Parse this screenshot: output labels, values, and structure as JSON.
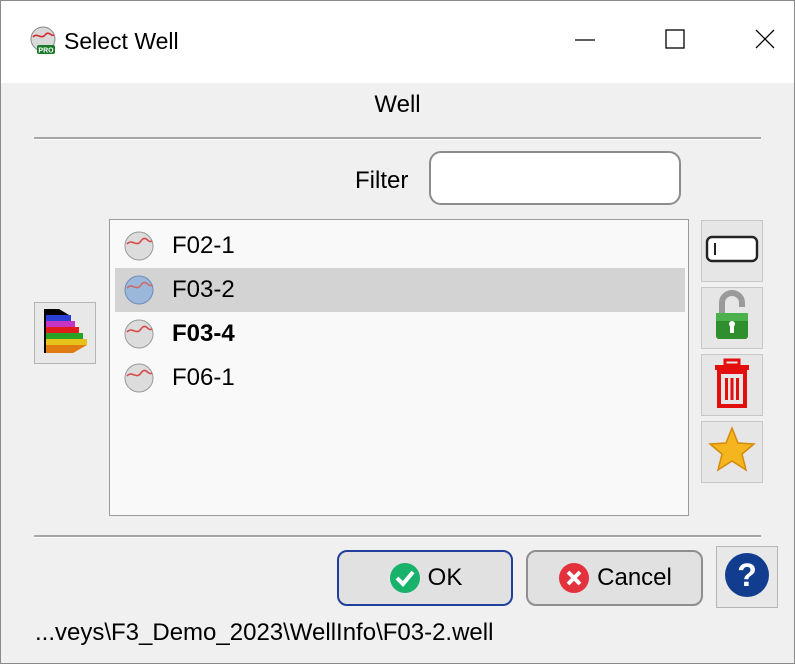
{
  "window": {
    "title": "Select Well",
    "minimize_icon": "minimize-icon",
    "maximize_icon": "maximize-icon",
    "close_icon": "close-icon"
  },
  "header": {
    "title": "Well"
  },
  "filter": {
    "label": "Filter",
    "value": "",
    "placeholder": ""
  },
  "list": {
    "items": [
      {
        "label": "F02-1",
        "icon": "well-icon",
        "selected": false,
        "bold": false
      },
      {
        "label": "F03-2",
        "icon": "well-icon-selected",
        "selected": true,
        "bold": false
      },
      {
        "label": "F03-4",
        "icon": "well-icon",
        "selected": false,
        "bold": true
      },
      {
        "label": "F06-1",
        "icon": "well-icon",
        "selected": false,
        "bold": false
      }
    ]
  },
  "side_tools": [
    "rename-icon",
    "unlock-icon",
    "trash-icon",
    "star-icon"
  ],
  "left_tool": "sort-icon",
  "buttons": {
    "ok": "OK",
    "cancel": "Cancel",
    "help_icon": "help-icon"
  },
  "status": {
    "path": "...veys\\F3_Demo_2023\\WellInfo\\F03-2.well"
  },
  "colors": {
    "accent": "#1f3f9a",
    "selection": "#d3d3d3"
  }
}
